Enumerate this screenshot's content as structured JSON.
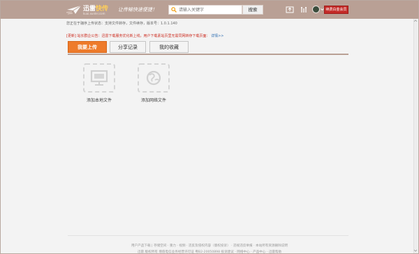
{
  "header": {
    "brand_prefix": "迅雷",
    "brand_highlight": "快传",
    "brand_domain": "kuai.xunlei.com",
    "slogan": "让传输快速便捷！",
    "search_placeholder": "请输入关键字",
    "search_button": "搜索",
    "vip_label": "续费白金会员",
    "icons": [
      "upload-icon",
      "tools-icon",
      "avatar",
      "chevron-down-icon"
    ]
  },
  "notice": {
    "text": "您正在于骊序上传状态：支持文件转存，文件续存，版本号：1.0.1.140"
  },
  "alert": {
    "text": "[更新] 站长群企公告：迅雷下载服务优化新上线，用户下载素站页里无需同网转存下载页面：",
    "more": "详情>>"
  },
  "tabs": [
    {
      "label": "我要上传",
      "active": true
    },
    {
      "label": "分享记录",
      "active": false
    },
    {
      "label": "我的收藏",
      "active": false
    }
  ],
  "actions": [
    {
      "label": "添加本地文件",
      "icon": "monitor-icon"
    },
    {
      "label": "添加网络文件",
      "icon": "globe-icon"
    }
  ],
  "footer": {
    "line1": "用户产品下载 | 存储空间 · 重力 · 视频 · 违反及侵权内容（版权投诉） · 违规违反举报 · 本站所有资源删除说明",
    "line2": "迅雷 版权所有 增值电信业务经营许可证 粤B2-20050898 投诉建议 · 网络中心 · 产品中心 · 迅雷帮助"
  },
  "colors": {
    "header_bg": "#b9a095",
    "tab_active": "#ee7b2b",
    "vip_red": "#c32a27",
    "alert_red": "#cc2b1f"
  }
}
